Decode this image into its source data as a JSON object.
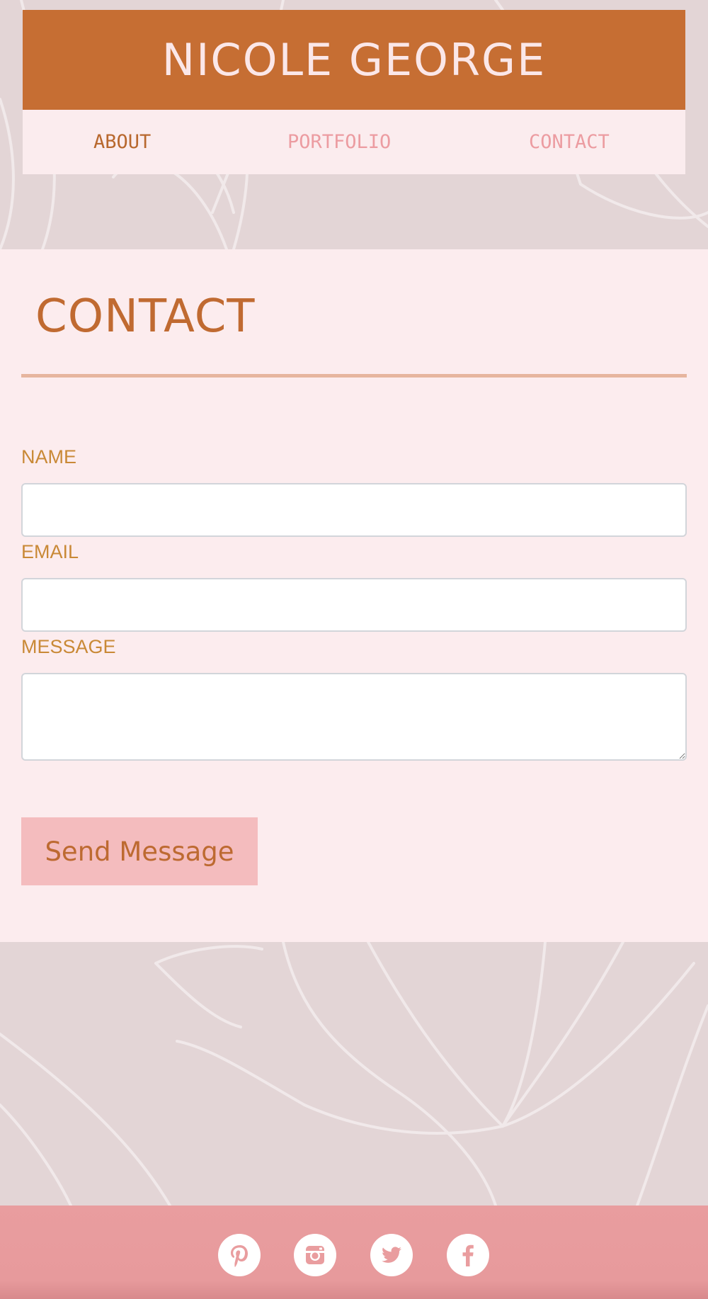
{
  "site": {
    "title": "NICOLE GEORGE"
  },
  "nav": {
    "items": [
      {
        "label": "ABOUT",
        "active": true
      },
      {
        "label": "PORTFOLIO",
        "active": false
      },
      {
        "label": "CONTACT",
        "active": false
      }
    ]
  },
  "contact": {
    "heading": "CONTACT",
    "fields": {
      "name": {
        "label": "NAME",
        "value": "",
        "placeholder": ""
      },
      "email": {
        "label": "EMAIL",
        "value": "",
        "placeholder": ""
      },
      "message": {
        "label": "MESSAGE",
        "value": "",
        "placeholder": ""
      }
    },
    "submit_label": "Send Message"
  },
  "footer": {
    "social": [
      {
        "icon": "pinterest-icon"
      },
      {
        "icon": "instagram-icon"
      },
      {
        "icon": "twitter-icon"
      },
      {
        "icon": "facebook-icon"
      }
    ]
  },
  "colors": {
    "brand_orange": "#c66e33",
    "nav_pink": "#ec9ca1",
    "panel_bg": "#fcecee",
    "label_gold": "#c98936",
    "button_pink": "#f4bcbe",
    "footer_pink": "#e99d9f",
    "page_bg": "#e3d5d6"
  }
}
